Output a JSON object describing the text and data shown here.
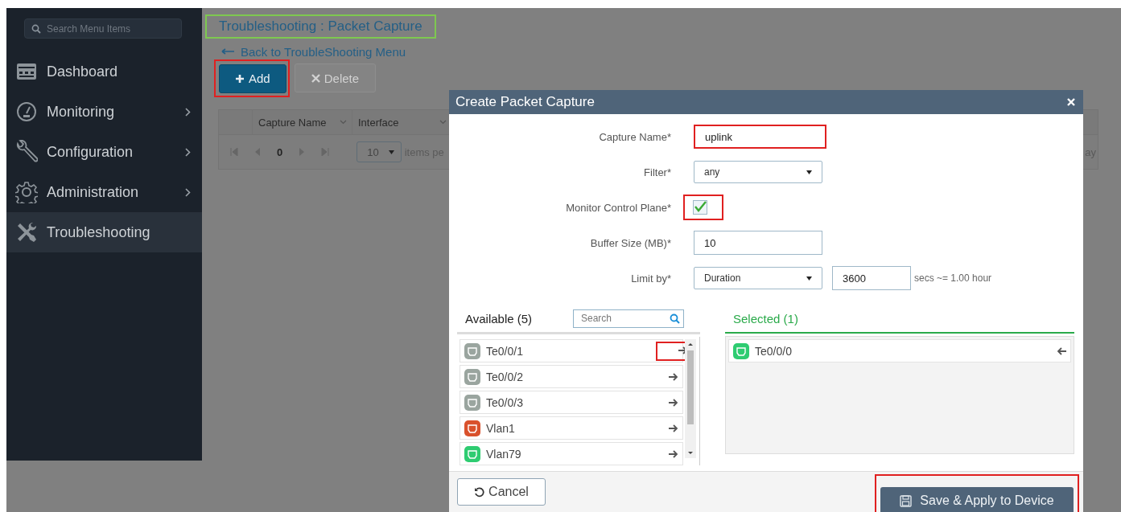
{
  "sidebar": {
    "search": {
      "placeholder": "Search Menu Items"
    },
    "items": [
      {
        "label": "Dashboard",
        "expandable": false,
        "selected": false
      },
      {
        "label": "Monitoring",
        "expandable": true,
        "selected": false
      },
      {
        "label": "Configuration",
        "expandable": true,
        "selected": false
      },
      {
        "label": "Administration",
        "expandable": true,
        "selected": false
      },
      {
        "label": "Troubleshooting",
        "expandable": false,
        "selected": true
      }
    ]
  },
  "page": {
    "title": "Troubleshooting : Packet Capture",
    "title_framed": true,
    "back_link": "Back to TroubleShooting Menu",
    "toolbar": [
      {
        "label": "Add",
        "disabled": false,
        "highlighted": true
      },
      {
        "label": "Delete",
        "disabled": true,
        "highlighted": false
      }
    ],
    "table": {
      "columns": [
        "Capture Name",
        "Interface"
      ],
      "pager": {
        "page": "0",
        "page_size": "10",
        "items_label": "items pe",
        "trailing": "ay"
      }
    }
  },
  "dialog": {
    "title": "Create Packet Capture",
    "fields": [
      {
        "kind": "text",
        "label": "Capture Name*",
        "value": "uplink",
        "highlighted": true
      },
      {
        "kind": "select",
        "label": "Filter*",
        "value": "any",
        "highlighted": false
      },
      {
        "kind": "checkbox",
        "label": "Monitor Control Plane*",
        "checked": true,
        "highlighted": true
      },
      {
        "kind": "text",
        "label": "Buffer Size (MB)*",
        "value": "10",
        "highlighted": false
      },
      {
        "kind": "limit",
        "label": "Limit by*",
        "value": "Duration",
        "amount": "3600",
        "note": "secs ~= 1.00 hour",
        "highlighted": false
      }
    ],
    "available": {
      "title": "Available (5)",
      "search_placeholder": "Search",
      "items": [
        {
          "name": "Te0/0/1",
          "color": "#9aa59f",
          "highlighted": true
        },
        {
          "name": "Te0/0/2",
          "color": "#9aa59f",
          "highlighted": false
        },
        {
          "name": "Te0/0/3",
          "color": "#9aa59f",
          "highlighted": false
        },
        {
          "name": "Vlan1",
          "color": "#d9512c",
          "highlighted": false
        },
        {
          "name": "Vlan79",
          "color": "#2ecc71",
          "highlighted": false
        }
      ]
    },
    "selected": {
      "title": "Selected (1)",
      "items": [
        {
          "name": "Te0/0/0",
          "color": "#2ecc71"
        }
      ]
    },
    "cancel": {
      "label": "Cancel"
    },
    "save": {
      "label": "Save & Apply to Device",
      "highlighted": true
    }
  }
}
